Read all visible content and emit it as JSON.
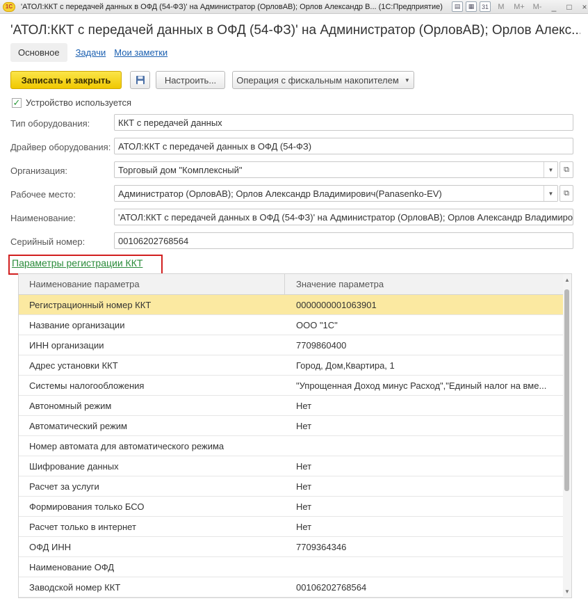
{
  "window": {
    "title": "'АТОЛ:ККТ с передачей данных в ОФД (54-ФЗ)' на Администратор (ОрловАВ); Орлов Александр В... (1С:Предприятие)",
    "logo": "1С",
    "controls": [
      "M",
      "M+",
      "M-",
      "_",
      "□",
      "×"
    ]
  },
  "header": {
    "title": "'АТОЛ:ККТ с передачей данных в ОФД (54-ФЗ)' на Администратор (ОрловАВ); Орлов Алекс..."
  },
  "tabs": [
    {
      "label": "Основное"
    },
    {
      "label": "Задачи"
    },
    {
      "label": "Мои заметки"
    }
  ],
  "toolbar": {
    "save_close_label": "Записать и закрыть",
    "settings_label": "Настроить...",
    "fiscal_op_label": "Операция с фискальным накопителем"
  },
  "device_used": {
    "label": "Устройство используется",
    "checked": true
  },
  "form": {
    "equipment_type": {
      "label": "Тип оборудования:",
      "value": "ККТ с передачей данных"
    },
    "driver": {
      "label": "Драйвер оборудования:",
      "value": "АТОЛ:ККТ с передачей данных в ОФД (54-ФЗ)"
    },
    "organization": {
      "label": "Организация:",
      "value": "Торговый дом \"Комплексный\""
    },
    "workplace": {
      "label": "Рабочее место:",
      "value": "Администратор (ОрловАВ); Орлов Александр Владимирович(Panasenko-EV)"
    },
    "name": {
      "label": "Наименование:",
      "value": "'АТОЛ:ККТ с передачей данных в ОФД (54-ФЗ)' на Администратор (ОрловАВ); Орлов Александр Владимиро"
    },
    "serial": {
      "label": "Серийный номер:",
      "value": "00106202768564"
    }
  },
  "registration_link": "Параметры регистрации ККТ",
  "params_table": {
    "columns": [
      "Наименование параметра",
      "Значение параметра"
    ],
    "rows": [
      [
        "Регистрационный номер ККТ",
        "0000000001063901"
      ],
      [
        "Название организации",
        "ООО \"1С\""
      ],
      [
        "ИНН организации",
        "7709860400"
      ],
      [
        "Адрес установки ККТ",
        "Город, Дом,Квартира, 1"
      ],
      [
        "Системы налогообложения",
        "\"Упрощенная Доход минус Расход\",\"Единый налог на вме..."
      ],
      [
        "Автономный режим",
        "Нет"
      ],
      [
        "Автоматический режим",
        "Нет"
      ],
      [
        "Номер автомата для автоматического режима",
        ""
      ],
      [
        "Шифрование данных",
        "Нет"
      ],
      [
        "Расчет за услуги",
        "Нет"
      ],
      [
        "Формирования только БСО",
        "Нет"
      ],
      [
        "Расчет только в интернет",
        "Нет"
      ],
      [
        "ОФД ИНН",
        "7709364346"
      ],
      [
        "Наименование ОФД",
        ""
      ],
      [
        "Заводской номер ККТ",
        "00106202768564"
      ]
    ],
    "selected_row": 0
  },
  "colors": {
    "primary_button": "#f0c800",
    "selected_row": "#fbe9a1",
    "link": "#1a5fb0",
    "section_link": "#2a8b3a",
    "highlight_border": "#d11f1f"
  }
}
